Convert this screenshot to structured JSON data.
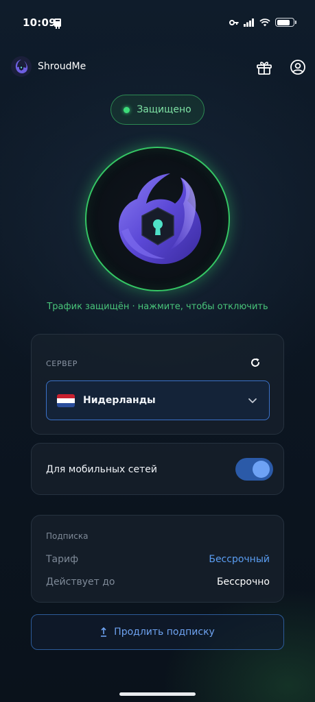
{
  "status_bar": {
    "time": "10:09",
    "battery_level": 0.8
  },
  "header": {
    "app_name": "ShroudMe",
    "gift_icon": "gift-icon",
    "profile_icon": "user-circle-icon"
  },
  "connection": {
    "status_label": "Защищено",
    "hint": "Трафик защищён · нажмите, чтобы отключить",
    "accent_color": "#35c765"
  },
  "server": {
    "label": "СЕРВЕР",
    "selected": "Нидерланды",
    "flag": "flag-netherlands-icon"
  },
  "mobile": {
    "label": "Для мобильных сетей",
    "enabled": true
  },
  "subscription": {
    "title": "Подписка",
    "plan_label": "Тариф",
    "plan_value": "Бессрочный",
    "valid_label": "Действует до",
    "valid_value": "Бессрочно"
  },
  "renew_button": {
    "label": "Продлить подписку"
  }
}
